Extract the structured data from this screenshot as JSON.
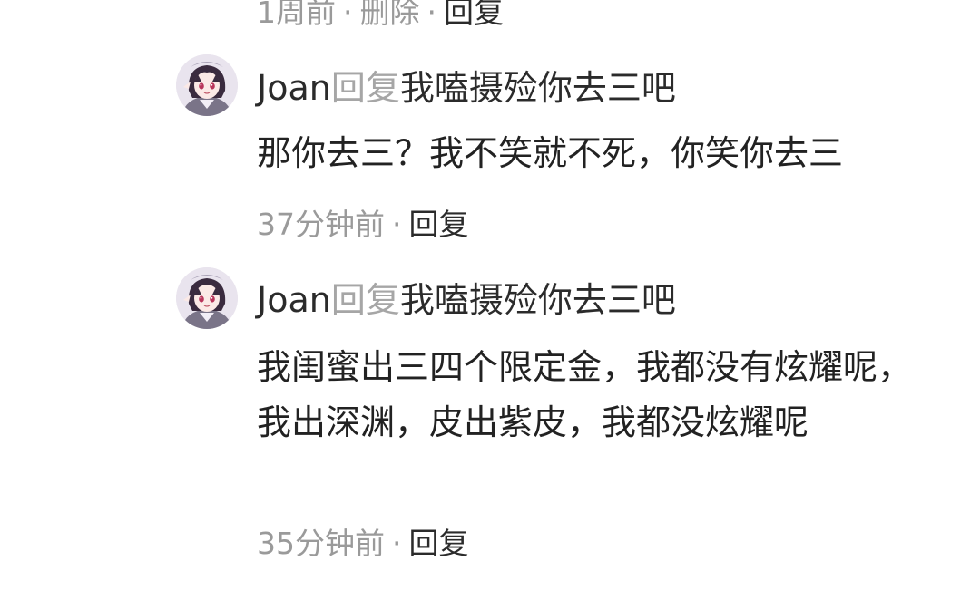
{
  "top_meta": {
    "time": "1周前",
    "delete_label": "删除",
    "reply_label": "回复"
  },
  "separator": "·",
  "comments": [
    {
      "user": "Joan",
      "reply_word": "回复",
      "reply_target": "我嗑摄殓你去三吧",
      "text": "那你去三？我不笑就不死，你笑你去三",
      "time": "37分钟前",
      "reply_label": "回复"
    },
    {
      "user": "Joan",
      "reply_word": "回复",
      "reply_target": "我嗑摄殓你去三吧",
      "text": "我闺蜜出三四个限定金，我都没有炫耀呢，我出深渊，皮出紫皮，我都没炫耀呢",
      "time": "35分钟前",
      "reply_label": "回复"
    }
  ],
  "colors": {
    "text_primary": "#222222",
    "text_muted": "#9a9a9a",
    "reply_word": "#a6a6a6",
    "background": "#ffffff"
  },
  "icons": {
    "avatar": "anime-girl-avatar"
  }
}
